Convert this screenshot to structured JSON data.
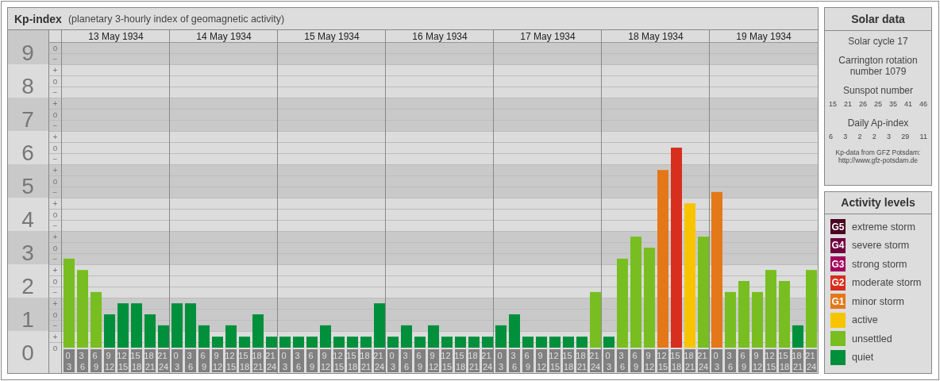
{
  "header": {
    "title": "Kp-index",
    "subtitle": "(planetary 3-hourly index of geomagnetic activity)"
  },
  "kp_chart": {
    "days": [
      "13 May 1934",
      "14 May 1934",
      "15 May 1934",
      "16 May 1934",
      "17 May 1934",
      "18 May 1934",
      "19 May 1934"
    ],
    "scale_marks": [
      "o",
      "−",
      "+",
      "o",
      "−",
      "+",
      "o",
      "−",
      "+",
      "o",
      "−",
      "+",
      "o",
      "−",
      "+",
      "o",
      "−",
      "+",
      "o",
      "−",
      "+",
      "o",
      "−",
      "+",
      "o",
      "−",
      "+",
      "o"
    ],
    "chart_data": {
      "type": "bar",
      "ylim": [
        0,
        9.3
      ],
      "yticks": [
        0,
        1,
        2,
        3,
        4,
        5,
        6,
        7,
        8,
        9
      ],
      "categories": [
        "0 3",
        "3 6",
        "6 9",
        "9 12",
        "12 15",
        "15 18",
        "18 21",
        "21 24",
        "0 3",
        "3 6",
        "6 9",
        "9 12",
        "12 15",
        "15 18",
        "18 21",
        "21 24",
        "0 3",
        "3 6",
        "6 9",
        "9 12",
        "12 15",
        "15 18",
        "18 21",
        "21 24",
        "0 3",
        "3 6",
        "6 9",
        "9 12",
        "12 15",
        "15 18",
        "18 21",
        "21 24",
        "0 3",
        "3 6",
        "6 9",
        "9 12",
        "12 15",
        "15 18",
        "18 21",
        "21 24",
        "0 3",
        "3 6",
        "6 9",
        "9 12",
        "12 15",
        "15 18",
        "18 21",
        "21 24",
        "0 3",
        "3 6",
        "6 9",
        "9 12",
        "12 15",
        "15 18",
        "18 21",
        "21 24"
      ],
      "grid": true,
      "series": [
        {
          "values": [
            2.67,
            2.33,
            1.67,
            1,
            1.33,
            1.33,
            1,
            0.67,
            1.33,
            1.33,
            0.67,
            0.33,
            0.67,
            0.33,
            1,
            0.33,
            0.33,
            0.33,
            0.33,
            0.67,
            0.33,
            0.33,
            0.33,
            1.33,
            0.33,
            0.67,
            0.33,
            0.67,
            0.33,
            0.33,
            0.33,
            0.33,
            0.67,
            1,
            0.33,
            0.33,
            0.33,
            0.33,
            0.33,
            1.67,
            0.33,
            2.67,
            3.33,
            3,
            5.33,
            6,
            4.33,
            3.33,
            4.67,
            1.67,
            2,
            1.67,
            2.33,
            2,
            0.67,
            2.33
          ]
        }
      ]
    }
  },
  "solar_data": {
    "title": "Solar data",
    "cycle": "Solar cycle 17",
    "rotation": "Carrington rotation number 1079",
    "sunspot_heading": "Sunspot number",
    "sunspot_numbers": [
      "15",
      "21",
      "26",
      "25",
      "35",
      "41",
      "46"
    ],
    "ap_heading": "Daily Ap-index",
    "ap_values": [
      "6",
      "3",
      "2",
      "2",
      "3",
      "29",
      "11"
    ],
    "source": "Kp-data from GFZ Potsdam:",
    "source_url": "http://www.gfz-potsdam.de"
  },
  "activity_levels": {
    "title": "Activity levels",
    "items": [
      {
        "badge": "G5",
        "label": "extreme storm",
        "color": "#4c0022"
      },
      {
        "badge": "G4",
        "label": "severe storm",
        "color": "#700040"
      },
      {
        "badge": "G3",
        "label": "strong storm",
        "color": "#a3005c"
      },
      {
        "badge": "G2",
        "label": "moderate storm",
        "color": "#d82e1e"
      },
      {
        "badge": "G1",
        "label": "minor storm",
        "color": "#e47818"
      },
      {
        "label": "active",
        "color": "#f8c400"
      },
      {
        "label": "unsettled",
        "color": "#78be20"
      },
      {
        "label": "quiet",
        "color": "#00903c"
      }
    ]
  }
}
